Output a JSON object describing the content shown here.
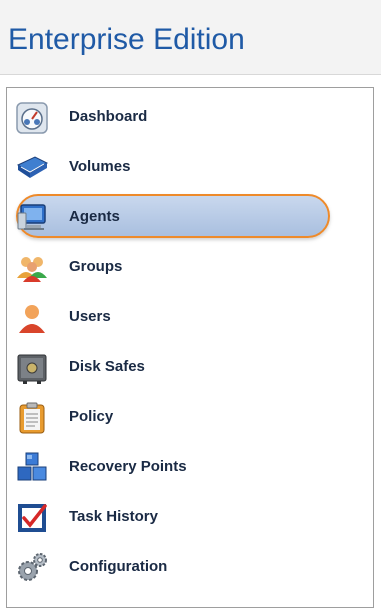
{
  "header": {
    "title": "Enterprise Edition"
  },
  "nav": {
    "items": [
      {
        "label": "Dashboard",
        "icon": "dashboard-icon",
        "selected": false
      },
      {
        "label": "Volumes",
        "icon": "volumes-icon",
        "selected": false
      },
      {
        "label": "Agents",
        "icon": "agents-icon",
        "selected": true
      },
      {
        "label": "Groups",
        "icon": "groups-icon",
        "selected": false
      },
      {
        "label": "Users",
        "icon": "user-icon",
        "selected": false
      },
      {
        "label": "Disk Safes",
        "icon": "disk-safe-icon",
        "selected": false
      },
      {
        "label": "Policy",
        "icon": "clipboard-icon",
        "selected": false
      },
      {
        "label": "Recovery Points",
        "icon": "cubes-icon",
        "selected": false
      },
      {
        "label": "Task History",
        "icon": "checkbox-icon",
        "selected": false
      },
      {
        "label": "Configuration",
        "icon": "gears-icon",
        "selected": false
      }
    ]
  },
  "colors": {
    "title": "#1f5aa6",
    "highlight_border": "#ee8a2a",
    "highlight_fill": "#b9cce6"
  }
}
